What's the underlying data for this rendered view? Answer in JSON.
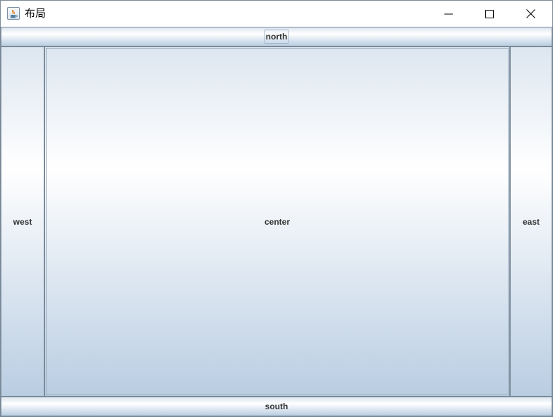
{
  "window": {
    "title": "布局",
    "icon": "java-coffee-icon",
    "controls": [
      "minimize-icon",
      "maximize-icon",
      "close-icon"
    ]
  },
  "layout": {
    "north": "north",
    "south": "south",
    "west": "west",
    "east": "east",
    "center": "center"
  }
}
